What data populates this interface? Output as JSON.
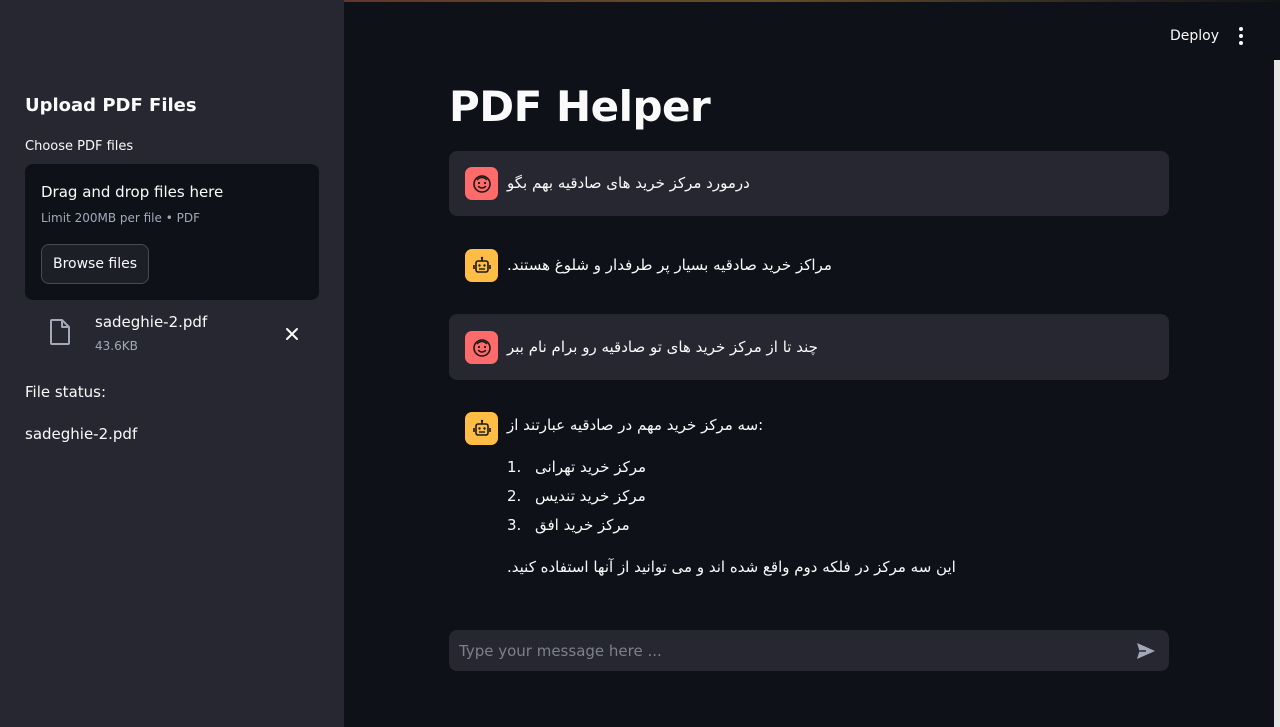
{
  "sidebar": {
    "title": "Upload PDF Files",
    "uploader_label": "Choose PDF files",
    "dropzone": {
      "title": "Drag and drop files here",
      "subtitle": "Limit 200MB per file • PDF",
      "browse_label": "Browse files"
    },
    "file": {
      "name": "sadeghie-2.pdf",
      "size": "43.6KB",
      "icon": "file-icon",
      "remove_icon": "close-icon"
    },
    "status_label": "File status:",
    "status_value": "sadeghie-2.pdf"
  },
  "header": {
    "deploy_label": "Deploy",
    "menu_icon": "vertical-dots-icon"
  },
  "main": {
    "title": "PDF Helper",
    "messages": [
      {
        "role": "user",
        "avatar_icon": "smiley-face-icon",
        "text": "درمورد مرکز خرید های صادقیه بهم بگو"
      },
      {
        "role": "assistant",
        "avatar_icon": "robot-icon",
        "text": ".مراکز خرید صادقیه بسیار پر طرفدار و شلوغ هستند"
      },
      {
        "role": "user",
        "avatar_icon": "smiley-face-icon",
        "text": "چند تا از مرکز خرید های تو صادقیه رو برام نام ببر"
      },
      {
        "role": "assistant",
        "avatar_icon": "robot-icon",
        "text": "سه مرکز خرید مهم در صادقیه عبارتند از:",
        "list": [
          {
            "num": "1.",
            "text": "مرکز خرید تهرانی"
          },
          {
            "num": "2.",
            "text": "مرکز خرید تندیس"
          },
          {
            "num": "3.",
            "text": "مرکز خرید افق"
          }
        ],
        "footer": ".این سه مرکز در فلکه دوم واقع شده اند و می توانید از آنها استفاده کنید"
      }
    ],
    "chat_input": {
      "placeholder": "Type your message here ...",
      "value": "",
      "send_icon": "send-icon"
    }
  },
  "colors": {
    "background": "#0e1117",
    "sidebar": "#262730",
    "user_avatar": "#ff6b6b",
    "bot_avatar": "#ffbd45",
    "text": "#fafafa",
    "muted_text": "#a3a8b8"
  }
}
